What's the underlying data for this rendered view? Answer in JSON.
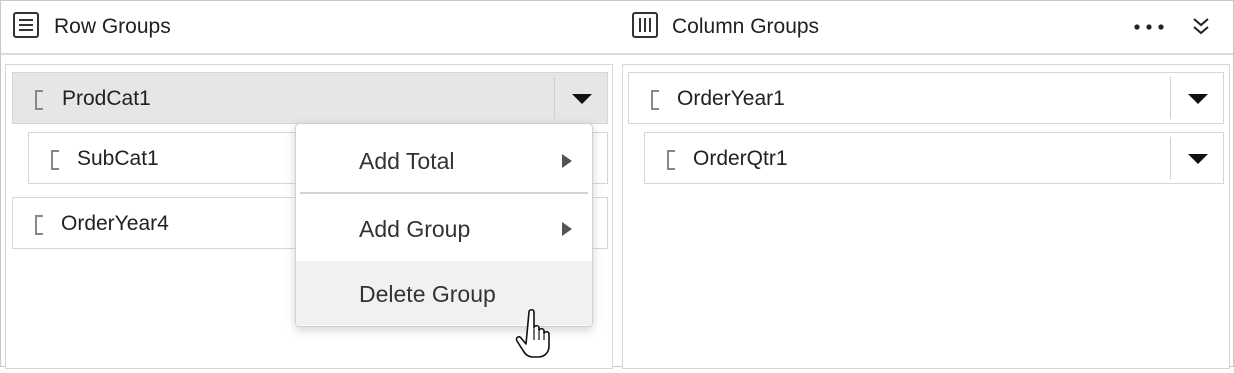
{
  "header": {
    "row_groups_title": "Row Groups",
    "row_groups_icon": "list-lines-icon",
    "column_groups_title": "Column Groups",
    "column_groups_icon": "columns-icon",
    "more_icon": "ellipsis-icon",
    "collapse_icon": "double-chevron-down-icon"
  },
  "row_groups": {
    "items": [
      {
        "label": "ProdCat1",
        "active": true
      },
      {
        "label": "SubCat1"
      },
      {
        "label": "OrderYear4"
      }
    ]
  },
  "column_groups": {
    "items": [
      {
        "label": "OrderYear1"
      },
      {
        "label": "OrderQtr1"
      }
    ]
  },
  "context_menu": {
    "items": [
      {
        "label": "Add Total",
        "has_submenu": true
      },
      {
        "label": "Add Group",
        "has_submenu": true
      },
      {
        "label": "Delete Group",
        "hovered": true
      }
    ]
  },
  "colors": {
    "active_item_bg": "#e6e6e6",
    "hover_item_bg": "#f1f1f1",
    "border": "#d6d6d6"
  }
}
